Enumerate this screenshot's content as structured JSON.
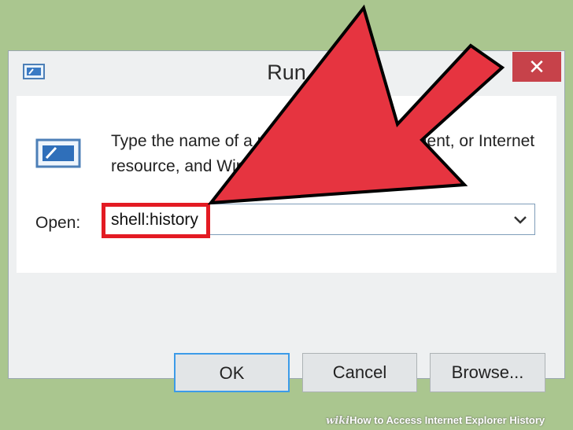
{
  "window": {
    "title": "Run",
    "close_label": "✕"
  },
  "content": {
    "description": "Type the name of a program, folder, document, or Internet resource, and Windows will open it for you.",
    "open_label": "Open:",
    "open_value": "shell:history"
  },
  "buttons": {
    "ok": "OK",
    "cancel": "Cancel",
    "browse": "Browse..."
  },
  "footer": {
    "brand": "wiki",
    "title": "How to Access Internet Explorer History"
  },
  "colors": {
    "annotation_red": "#e31b23",
    "close_red": "#c7424a",
    "background_green": "#aac68f"
  }
}
